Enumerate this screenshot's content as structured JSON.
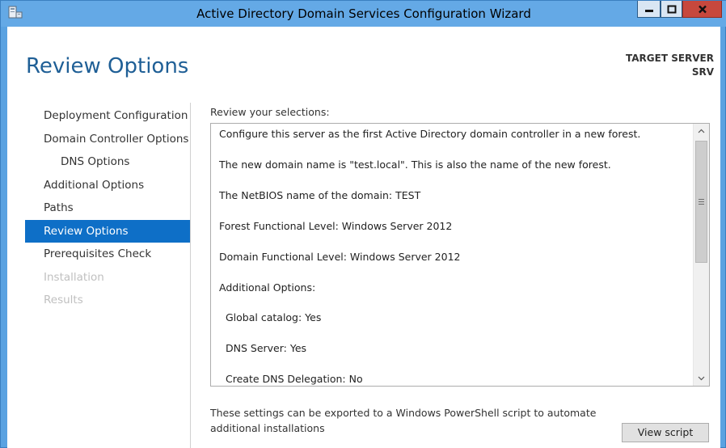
{
  "window": {
    "title": "Active Directory Domain Services Configuration Wizard"
  },
  "header": {
    "page_title": "Review Options",
    "target_label": "TARGET SERVER",
    "target_name": "SRV"
  },
  "nav": {
    "items": [
      {
        "label": "Deployment Configuration",
        "state": "normal"
      },
      {
        "label": "Domain Controller Options",
        "state": "normal"
      },
      {
        "label": "DNS Options",
        "state": "normal"
      },
      {
        "label": "Additional Options",
        "state": "normal"
      },
      {
        "label": "Paths",
        "state": "normal"
      },
      {
        "label": "Review Options",
        "state": "active"
      },
      {
        "label": "Prerequisites Check",
        "state": "normal"
      },
      {
        "label": "Installation",
        "state": "disabled"
      },
      {
        "label": "Results",
        "state": "disabled"
      }
    ]
  },
  "main": {
    "review_label": "Review your selections:",
    "review_lines": [
      "Configure this server as the first Active Directory domain controller in a new forest.",
      "The new domain name is \"test.local\". This is also the name of the new forest.",
      "The NetBIOS name of the domain: TEST",
      "Forest Functional Level: Windows Server 2012",
      "Domain Functional Level: Windows Server 2012",
      "Additional Options:",
      "Global catalog: Yes",
      "DNS Server: Yes",
      "Create DNS Delegation: No"
    ],
    "export_text": "These settings can be exported to a Windows PowerShell script to automate additional installations",
    "view_script_label": "View script"
  },
  "colors": {
    "accent": "#0e6fc7",
    "title_blue": "#1f5f96",
    "frame": "#64a9e6",
    "close_red": "#c7483d"
  },
  "icons": {
    "app": "server-manager-icon",
    "minimize": "minimize-icon",
    "maximize": "maximize-icon",
    "close": "close-icon",
    "scroll_up": "chevron-up-icon",
    "scroll_down": "chevron-down-icon",
    "scroll_grip": "grip-icon"
  }
}
